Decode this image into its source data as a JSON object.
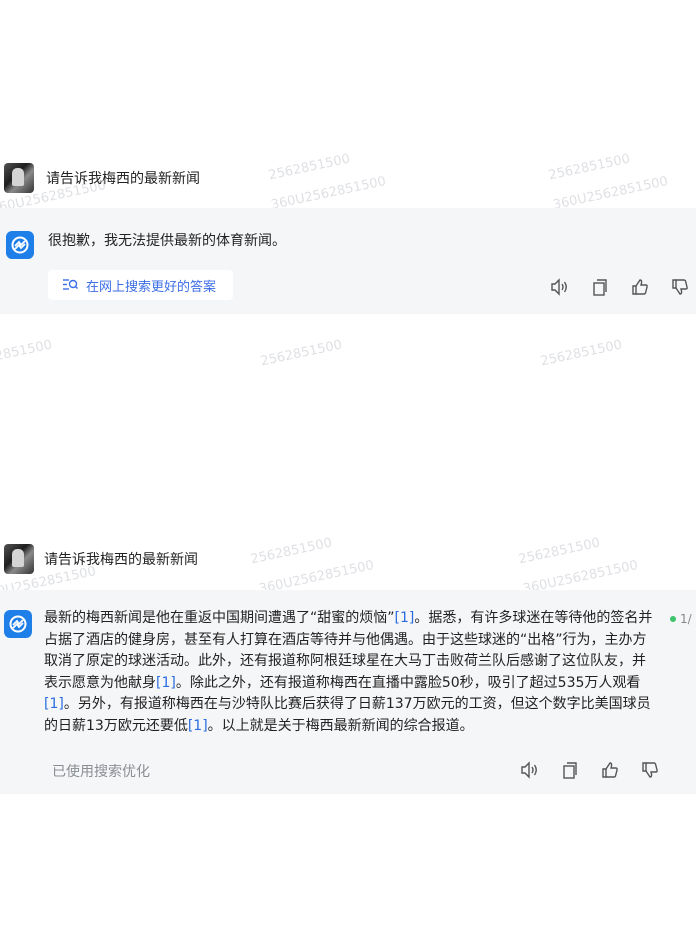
{
  "watermark": {
    "line1": "2562851500",
    "line2": "360U2562851500"
  },
  "conversation1": {
    "user_message": "请告诉我梅西的最新新闻",
    "bot_message": "很抱歉，我无法提供最新的体育新闻。",
    "search_button_label": "在网上搜索更好的答案"
  },
  "conversation2": {
    "user_message": "请告诉我梅西的最新新闻",
    "bot_paragraph": {
      "p1": "最新的梅西新闻是他在重返中国期间遭遇了“甜蜜的烦恼”",
      "r1": "[1]",
      "p2": "。据悉，有许多球迷在等待他的签名并占据了酒店的健身房，甚至有人打算在酒店等待并与他偶遇。由于这些球迷的“出格”行为，主办方取消了原定的球迷活动。此外，还有报道称阿根廷球星在大马丁击败荷兰队后感谢了这位队友，并表示愿意为他献身",
      "r2": "[1]",
      "p3": "。除此之外，还有报道称梅西在直播中露脸50秒，吸引了超过535万人观看",
      "r3": "[1]",
      "p4": "。另外，有报道称梅西在与沙特队比赛后获得了日薪137万欧元的工资，但这个数字比美国球员的日薪13万欧元还要低",
      "r4": "[1]",
      "p5": "。以上就是关于梅西最新新闻的综合报道。"
    },
    "used_search_label": "已使用搜索优化",
    "progress_label": "1/"
  },
  "colors": {
    "accent": "#1f7fe8",
    "link": "#2b6de0",
    "block_bg": "#f5f6f8",
    "status_dot": "#3cc36b"
  },
  "icons": [
    "speaker-icon",
    "copy-icon",
    "thumbs-up-icon",
    "thumbs-down-icon",
    "search-list-icon",
    "bot-logo-icon"
  ]
}
